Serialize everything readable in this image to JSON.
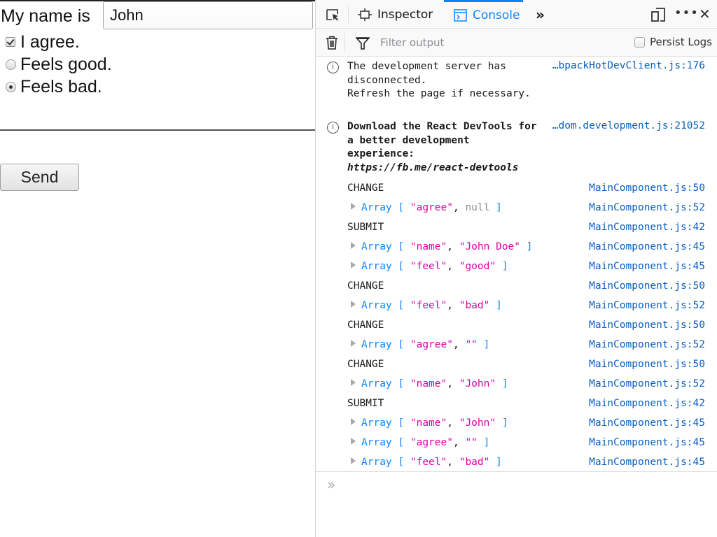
{
  "page": {
    "name_label": "My name is",
    "name_value": "John",
    "agree_label": "I agree.",
    "agree_checked": true,
    "feel_options": [
      {
        "label": "Feels good.",
        "value": "good",
        "selected": false
      },
      {
        "label": "Feels bad.",
        "value": "bad",
        "selected": true
      }
    ],
    "send_label": "Send"
  },
  "devtools": {
    "tabs": [
      {
        "label": "Inspector",
        "icon": "inspector-icon",
        "active": false
      },
      {
        "label": "Console",
        "icon": "console-icon",
        "active": true
      }
    ],
    "more_tabs_glyph": "»",
    "menu_glyph": "•••",
    "close_glyph": "✕",
    "filter": {
      "placeholder": "Filter output",
      "value": ""
    },
    "persist_logs": {
      "label": "Persist Logs",
      "checked": false
    },
    "colors": {
      "accent": "#0a84ff",
      "string": "#dd00a9",
      "source_link": "#0a5fbf",
      "null": "#8a8a8f"
    },
    "messages": [
      {
        "type": "info",
        "text": "The development server has disconnected.\nRefresh the page if necessary.",
        "source": "…bpackHotDevClient.js:176"
      },
      {
        "type": "info",
        "text_bold": "Download the React DevTools for a better development experience: ",
        "text_link": "https://fb.me/react-devtools",
        "source": "…dom.development.js:21052"
      }
    ],
    "logs": [
      {
        "kind": "text",
        "text": "CHANGE",
        "source": "MainComponent.js:50"
      },
      {
        "kind": "array",
        "items": [
          "\"agree\"",
          "null"
        ],
        "source": "MainComponent.js:52"
      },
      {
        "kind": "text",
        "text": "SUBMIT",
        "source": "MainComponent.js:42"
      },
      {
        "kind": "array",
        "items": [
          "\"name\"",
          "\"John Doe\""
        ],
        "source": "MainComponent.js:45"
      },
      {
        "kind": "array",
        "items": [
          "\"feel\"",
          "\"good\""
        ],
        "source": "MainComponent.js:45"
      },
      {
        "kind": "text",
        "text": "CHANGE",
        "source": "MainComponent.js:50"
      },
      {
        "kind": "array",
        "items": [
          "\"feel\"",
          "\"bad\""
        ],
        "source": "MainComponent.js:52"
      },
      {
        "kind": "text",
        "text": "CHANGE",
        "source": "MainComponent.js:50"
      },
      {
        "kind": "array",
        "items": [
          "\"agree\"",
          "\"\""
        ],
        "source": "MainComponent.js:52"
      },
      {
        "kind": "text",
        "text": "CHANGE",
        "source": "MainComponent.js:50"
      },
      {
        "kind": "array",
        "items": [
          "\"name\"",
          "\"John\""
        ],
        "source": "MainComponent.js:52"
      },
      {
        "kind": "text",
        "text": "SUBMIT",
        "source": "MainComponent.js:42"
      },
      {
        "kind": "array",
        "items": [
          "\"name\"",
          "\"John\""
        ],
        "source": "MainComponent.js:45"
      },
      {
        "kind": "array",
        "items": [
          "\"agree\"",
          "\"\""
        ],
        "source": "MainComponent.js:45"
      },
      {
        "kind": "array",
        "items": [
          "\"feel\"",
          "\"bad\""
        ],
        "source": "MainComponent.js:45"
      }
    ],
    "array_keyword": "Array",
    "prompt_glyph": "»"
  }
}
